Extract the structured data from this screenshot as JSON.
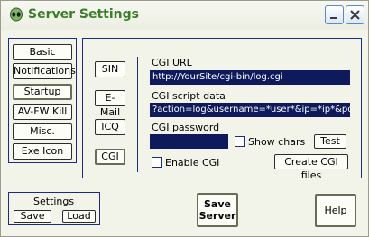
{
  "window": {
    "title": "Server Settings",
    "minimize_label": "—",
    "close_label": "✕"
  },
  "nav": {
    "items": [
      "Basic",
      "Notifications",
      "Startup",
      "AV-FW Kill",
      "Misc.",
      "Exe Icon"
    ],
    "selected": "Startup"
  },
  "sub_tabs": [
    "SIN",
    "E-Mail",
    "ICQ",
    "CGI"
  ],
  "cgi": {
    "url_label": "CGI URL",
    "url_value": "http://YourSite/cgi-bin/log.cgi",
    "script_label": "CGI script data",
    "script_value": "?action=log&username=*user*&ip=*ip*&port=*p",
    "password_label": "CGI password",
    "password_value": "",
    "show_chars_label": "Show chars",
    "test_label": "Test",
    "enable_label": "Enable CGI",
    "create_files_label": "Create CGI files"
  },
  "settings_group": {
    "title": "Settings",
    "save_label": "Save",
    "load_label": "Load"
  },
  "save_server": {
    "line1": "Save",
    "line2": "Server"
  },
  "help_label": "Help"
}
